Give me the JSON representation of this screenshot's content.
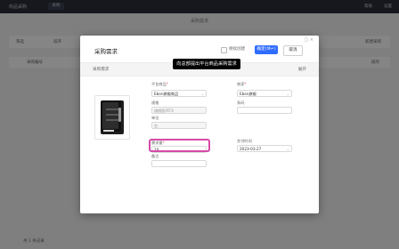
{
  "background": {
    "brand": "商品采购",
    "tab": "采购",
    "page_title": "采购需求",
    "toolbar": [
      "筛选",
      "排序",
      "新建采购"
    ],
    "table_header": [
      "采购编号",
      "操作"
    ],
    "footer_text": "共 1 条记录",
    "top_right_1": "帮助",
    "top_right_2": "设置"
  },
  "modal": {
    "title": "采购需求",
    "continue_checkbox_label": "继续创建",
    "confirm_button": "确定(⌘↵)",
    "cancel_button": "取消",
    "tooltip": "向总部提出平台商品采购需求",
    "info_bar": {
      "left": "采购需求",
      "right": "展开"
    },
    "window_controls": "□ ×"
  },
  "form": {
    "platform_product_label": "平台商品",
    "platform_product_value": "Ebon旗舰商品",
    "merchant_label": "商家",
    "merchant_value": "Ebon旗舰",
    "sku_label": "规格",
    "sku_value": "旗舰版/RTX",
    "barcode_label": "条码",
    "barcode_value": "",
    "unit_label": "单位",
    "unit_value": "台",
    "qty_label": "需求量",
    "qty_value": "10",
    "date_label": "交付时间",
    "date_value": "2023-03-27",
    "remark_label": "备注",
    "remark_value": ""
  },
  "colors": {
    "primary": "#2f6bff",
    "highlight": "#d64aa7",
    "required": "#e54545"
  },
  "icons": [
    "chevron-down-icon",
    "checkbox-icon",
    "pc-case-image"
  ]
}
